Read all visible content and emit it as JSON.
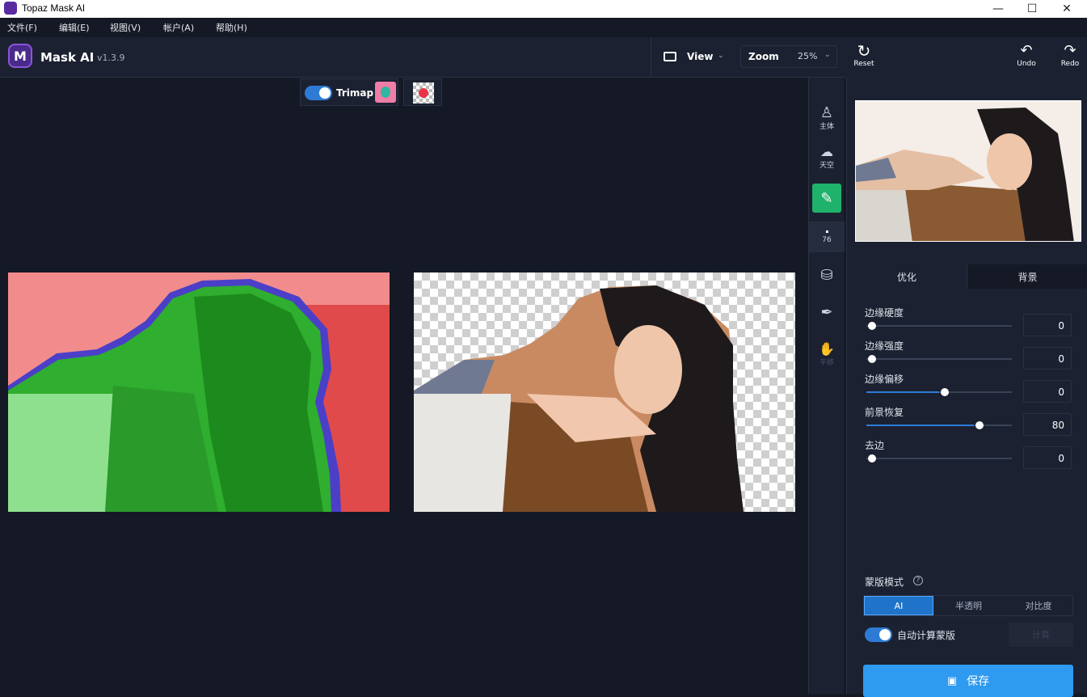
{
  "window": {
    "title": "Topaz Mask AI",
    "controls": [
      "—",
      "☐",
      "✕"
    ]
  },
  "menu": {
    "items": [
      "文件(F)",
      "编辑(E)",
      "视图(V)",
      "帐户(A)",
      "帮助(H)"
    ]
  },
  "header": {
    "logo_letter": "M",
    "app_name": "Mask AI",
    "version": "v1.3.9",
    "view_label": "View",
    "zoom_label": "Zoom",
    "zoom_value": "25%"
  },
  "top_tools": {
    "reset": "Reset",
    "undo": "Undo",
    "redo": "Redo"
  },
  "canvas": {
    "trimap_label": "Trimap"
  },
  "vertical_tools": {
    "subject": "主体",
    "sky": "天空",
    "brush_size": "76",
    "pan": "平移"
  },
  "right_panel": {
    "tabs": [
      "优化",
      "背景"
    ],
    "sliders": [
      {
        "label": "边缘硬度",
        "value": "0",
        "fraction": 0.0
      },
      {
        "label": "边缘强度",
        "value": "0",
        "fraction": 0.0
      },
      {
        "label": "边缘偏移",
        "value": "0",
        "fraction": 0.5
      },
      {
        "label": "前景恢复",
        "value": "80",
        "fraction": 0.74
      },
      {
        "label": "去边",
        "value": "0",
        "fraction": 0.0
      }
    ],
    "mask_mode_label": "蒙版模式",
    "mask_modes": [
      "AI",
      "半透明",
      "对比度"
    ],
    "auto_calc_label": "自动计算蒙版",
    "calc_button": "计算",
    "save_button": "保存"
  },
  "colors": {
    "accent": "#2e7bd6",
    "save": "#2e9af0",
    "brush_green": "#1fb26a"
  }
}
